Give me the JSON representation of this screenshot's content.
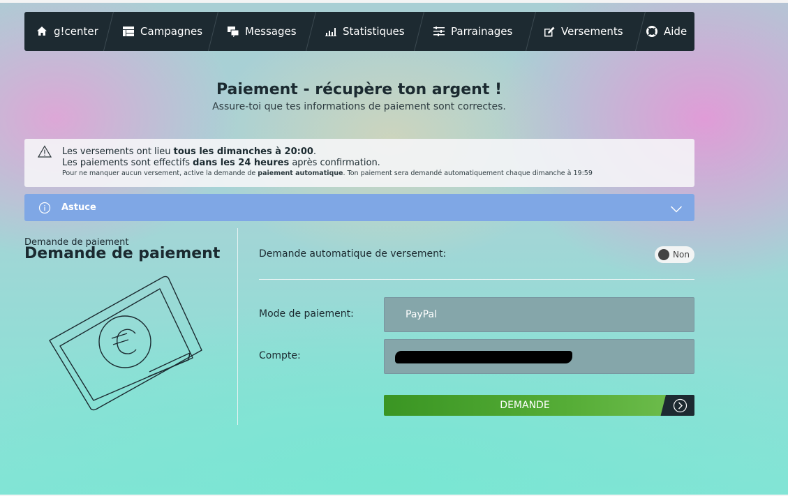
{
  "nav": {
    "items": [
      {
        "label": "g!center",
        "icon": "home-icon"
      },
      {
        "label": "Campagnes",
        "icon": "campaigns-icon"
      },
      {
        "label": "Messages",
        "icon": "messages-icon"
      },
      {
        "label": "Statistiques",
        "icon": "bar-chart-icon"
      },
      {
        "label": "Parrainages",
        "icon": "sliders-icon"
      },
      {
        "label": "Versements",
        "icon": "edit-icon"
      },
      {
        "label": "Aide",
        "icon": "lifebuoy-icon"
      }
    ]
  },
  "header": {
    "title": "Paiement - récupère ton argent !",
    "subtitle": "Assure-toi que tes informations de paiement sont correctes."
  },
  "alert": {
    "icon": "warning-icon",
    "line1_pre": "Les versements ont lieu ",
    "line1_bold": "tous les dimanches à 20:00",
    "line1_post": ".",
    "line2_pre": "Les paiements sont effectifs ",
    "line2_bold": "dans les 24 heures",
    "line2_post": " après confirmation.",
    "line3_pre": "Pour ne manquer aucun versement, active la demande de ",
    "line3_bold": "paiement automatique",
    "line3_post": ". Ton paiement sera demandé automatiquement chaque dimanche à 19:59"
  },
  "tip": {
    "label": "Astuce",
    "icon": "info-icon"
  },
  "left": {
    "small_title": "Demande de paiement",
    "big_title": "Demande de paiement",
    "illustration": "money-euro-icon"
  },
  "form": {
    "auto_label": "Demande automatique de versement:",
    "auto_toggle": "Non",
    "mode_label": "Mode de paiement:",
    "mode_value": "PayPal",
    "account_label": "Compte:",
    "account_value": "",
    "submit_label": "DEMANDE"
  },
  "colors": {
    "nav_bg": "#1d2a31",
    "tip_bg": "#7fa7e5",
    "field_bg": "#85a6aa",
    "submit_green": "#56ad37"
  }
}
